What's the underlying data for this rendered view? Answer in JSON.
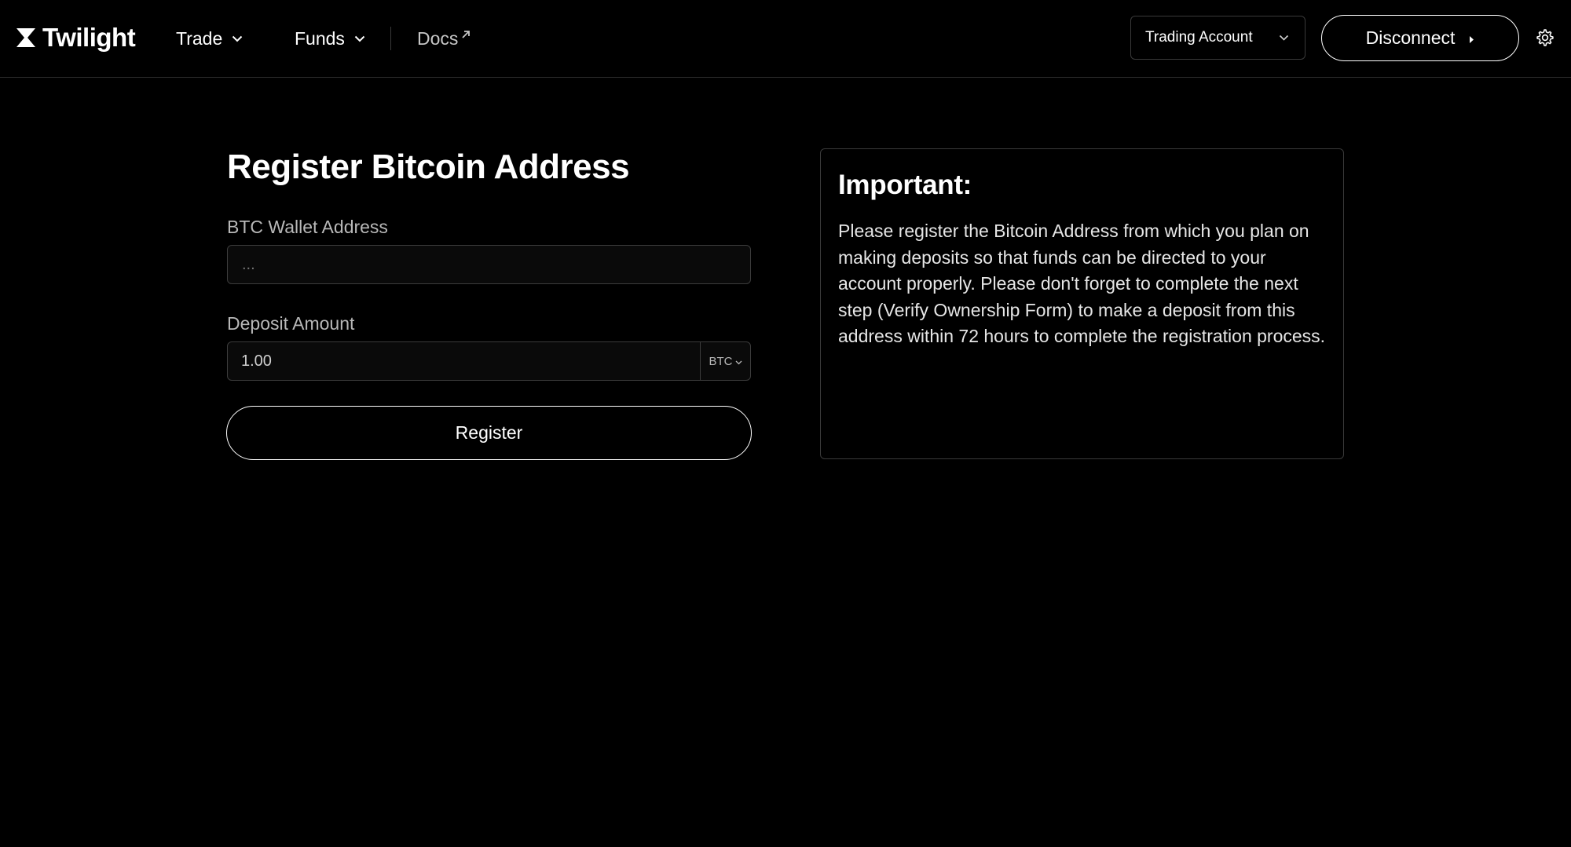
{
  "header": {
    "brand": "Twilight",
    "nav": [
      {
        "label": "Trade"
      },
      {
        "label": "Funds"
      },
      {
        "label": "Docs"
      }
    ],
    "account_select": "Trading Account",
    "disconnect_label": "Disconnect"
  },
  "form": {
    "title": "Register Bitcoin Address",
    "wallet_label": "BTC Wallet Address",
    "wallet_placeholder": "...",
    "amount_label": "Deposit Amount",
    "amount_value": "1.00",
    "currency": "BTC",
    "register_label": "Register"
  },
  "info": {
    "title": "Important:",
    "body": "Please register the Bitcoin Address from which you plan on making deposits so that funds can be directed to your account properly. Please don't forget to complete the next step (Verify Ownership Form) to make a deposit from this address within 72 hours to complete the registration process."
  }
}
